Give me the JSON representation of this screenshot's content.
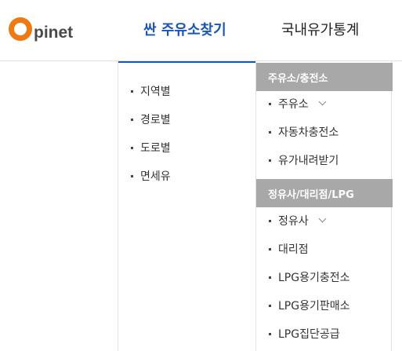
{
  "header": {
    "logo": {
      "letter": "O",
      "text": "pinet"
    },
    "nav": [
      {
        "label": "싼 주유소찾기"
      },
      {
        "label": "국내유가통계"
      }
    ]
  },
  "dropdown": {
    "left_items": [
      {
        "label": "지역별"
      },
      {
        "label": "경로별"
      },
      {
        "label": "도로별"
      },
      {
        "label": "면세유"
      }
    ],
    "sections": [
      {
        "title": "주유소/충전소",
        "items": [
          {
            "label": "주유소",
            "icon": "chevron-down-icon"
          },
          {
            "label": "자동차충전소"
          },
          {
            "label": "유가내려받기"
          }
        ]
      },
      {
        "title": "정유사/대리점/LPG",
        "items": [
          {
            "label": "정유사",
            "icon": "chevron-down-icon"
          },
          {
            "label": "대리점"
          },
          {
            "label": "LPG용기충전소"
          },
          {
            "label": "LPG용기판매소"
          },
          {
            "label": "LPG집단공급"
          }
        ]
      }
    ]
  },
  "colors": {
    "brand_orange": "#f07a12",
    "active_blue": "#1b56b6",
    "section_gray": "#a8a8a8"
  }
}
